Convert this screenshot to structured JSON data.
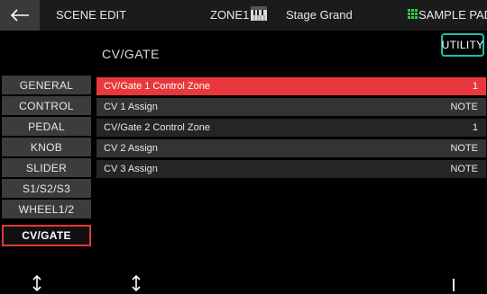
{
  "header": {
    "screen_title": "SCENE EDIT",
    "zone": "ZONE1",
    "tone_name": "Stage Grand",
    "sample_pad_label": "SAMPLE PAD"
  },
  "page": {
    "title": "CV/GATE",
    "utility_label": "UTILITY"
  },
  "tabs": [
    {
      "label": "GENERAL"
    },
    {
      "label": "CONTROL"
    },
    {
      "label": "PEDAL"
    },
    {
      "label": "KNOB"
    },
    {
      "label": "SLIDER"
    },
    {
      "label": "S1/S2/S3"
    },
    {
      "label": "WHEEL1/2"
    },
    {
      "label": "CV/GATE"
    }
  ],
  "active_tab": "CV/GATE",
  "params": [
    {
      "name": "CV/Gate 1 Control Zone",
      "value": "1"
    },
    {
      "name": "CV 1 Assign",
      "value": "NOTE"
    },
    {
      "name": "CV/Gate 2 Control Zone",
      "value": "1"
    },
    {
      "name": "CV 2 Assign",
      "value": "NOTE"
    },
    {
      "name": "CV 3 Assign",
      "value": "NOTE"
    }
  ],
  "selected_param": "CV/Gate 1 Control Zone",
  "icons": {
    "back": "left-arrow-icon",
    "zone_keyboard": "piano-keyboard-icon",
    "sample_pad": "grid-icon",
    "bottom_left": "up-down-arrow-icon",
    "bottom_middle": "up-down-arrow-icon"
  },
  "colors": {
    "accent_red": "#e8383d",
    "utility_border": "#1dbfa8",
    "sample_pad_green": "#2ecc40",
    "tab_bg": "#3c3c3c"
  }
}
